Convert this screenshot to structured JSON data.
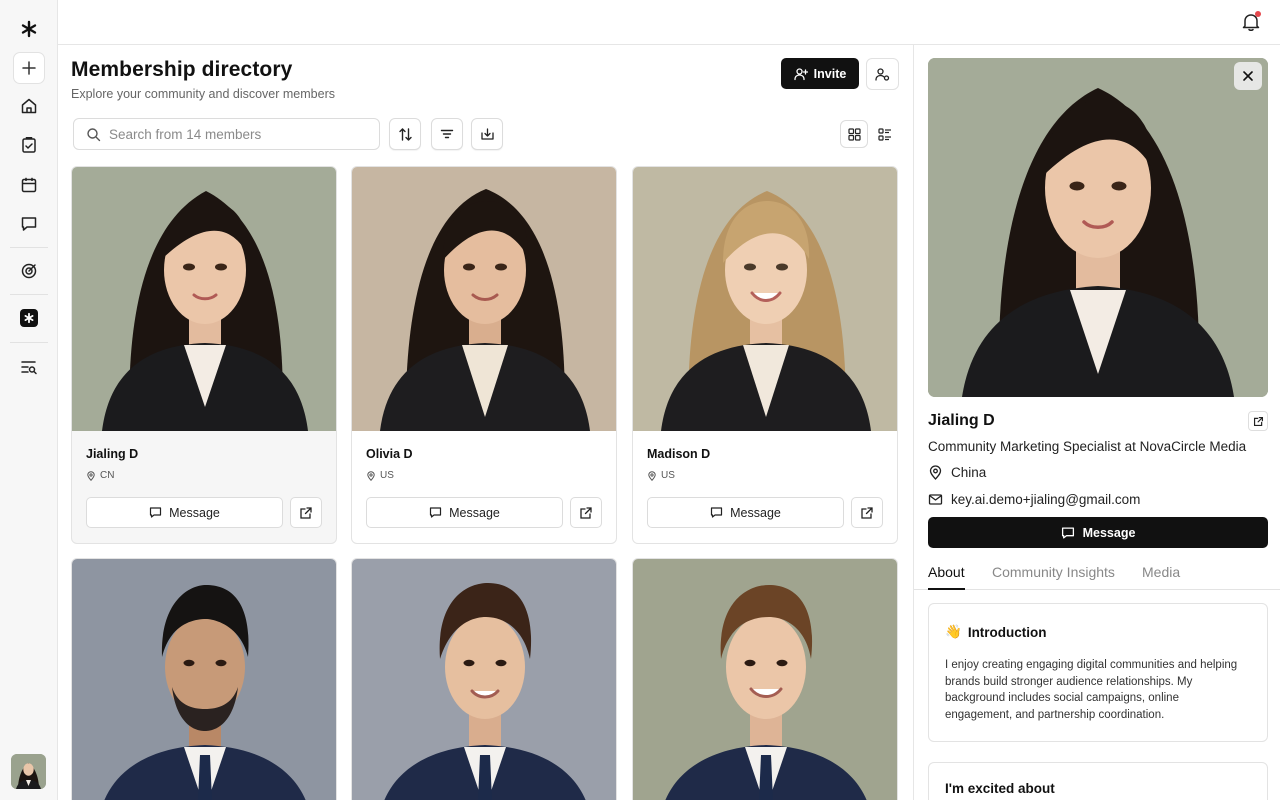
{
  "colors": {
    "accent": "#111111",
    "notification": "#e5484d",
    "card_bg_selected": "#f6f6f6"
  },
  "rail": {
    "logo_icon": "asterisk-logo-icon",
    "items": [
      {
        "name": "add",
        "icon": "plus-icon"
      },
      {
        "name": "home",
        "icon": "home-icon"
      },
      {
        "name": "tasks",
        "icon": "clipboard-icon"
      },
      {
        "name": "calendar",
        "icon": "calendar-icon"
      },
      {
        "name": "messages",
        "icon": "chat-icon"
      },
      {
        "name": "insights",
        "icon": "target-icon"
      },
      {
        "name": "community",
        "icon": "asterisk-app-icon"
      },
      {
        "name": "search-list",
        "icon": "list-search-icon"
      }
    ]
  },
  "header": {
    "notification_icon": "bell-icon"
  },
  "main": {
    "title": "Membership directory",
    "subtitle": "Explore your community and discover members",
    "invite_label": "Invite",
    "search": {
      "placeholder": "Search from 14 members"
    },
    "toolbar": [
      "sort-icon",
      "filter-icon",
      "download-icon"
    ],
    "views": [
      "grid-view-icon",
      "list-view-icon"
    ],
    "members": [
      {
        "name": "Jialing D",
        "location": "CN",
        "message_label": "Message"
      },
      {
        "name": "Olivia D",
        "location": "US",
        "message_label": "Message"
      },
      {
        "name": "Madison D",
        "location": "US",
        "message_label": "Message"
      },
      {
        "name": "",
        "location": "",
        "message_label": ""
      },
      {
        "name": "",
        "location": "",
        "message_label": ""
      },
      {
        "name": "",
        "location": "",
        "message_label": ""
      }
    ]
  },
  "profile": {
    "name": "Jialing D",
    "role": "Community Marketing Specialist at NovaCircle Media",
    "location": "China",
    "email": "key.ai.demo+jialing@gmail.com",
    "message_label": "Message",
    "tabs": [
      "About",
      "Community Insights",
      "Media"
    ],
    "intro_emoji": "👋",
    "intro_title": "Introduction",
    "intro_body": "I enjoy creating engaging digital communities and helping brands build stronger audience relationships. My background includes social campaigns, online engagement, and partnership coordination.",
    "excited_title": "I'm excited about"
  }
}
